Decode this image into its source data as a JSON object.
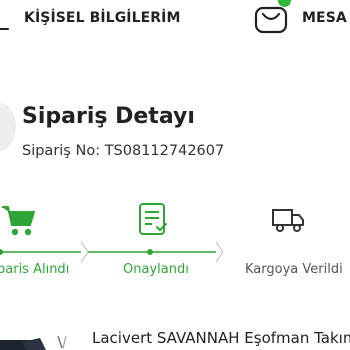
{
  "nav": {
    "profile_label": "KİŞİSEL BİLGİLERİM",
    "messages_label": "MESA"
  },
  "order": {
    "title": "Sipariş Detayı",
    "number_text": "Sipariş No: TS08112742607"
  },
  "tracker": {
    "steps": [
      {
        "label": "paris Alındı",
        "status": "done",
        "icon": "shopping-cart-icon"
      },
      {
        "label": "Onaylandı",
        "status": "done",
        "icon": "approved-document-icon"
      },
      {
        "label": "Kargoya Verildi",
        "status": "pending",
        "icon": "delivery-truck-icon"
      }
    ]
  },
  "product": {
    "name": "Lacivert SAVANNAH Eşofman Takım"
  },
  "colors": {
    "accent_green": "#2fa437",
    "pending_gray": "#555555"
  }
}
